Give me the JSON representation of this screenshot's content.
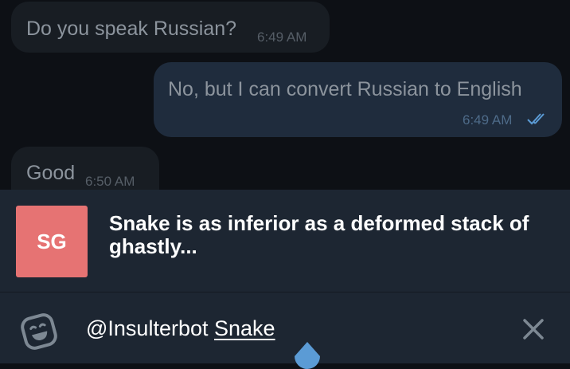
{
  "chat": {
    "messages": [
      {
        "direction": "incoming",
        "text": "Do you speak Russian?",
        "time": "6:49 AM"
      },
      {
        "direction": "outgoing",
        "text": "No, but I can convert Russian to English",
        "time": "6:49 AM",
        "status_icon": "double-check-icon"
      },
      {
        "direction": "incoming",
        "text": "Good",
        "time": "6:50 AM"
      }
    ]
  },
  "suggestion": {
    "avatar_initials": "SG",
    "avatar_color": "#e67373",
    "text": "Snake is as inferior as a deformed stack of ghastly..."
  },
  "input": {
    "mention": "@Insulterbot",
    "query": "Snake",
    "left_icon": "emoji-icon",
    "right_icon": "close-icon"
  },
  "colors": {
    "background": "#0d1015",
    "incoming_bubble": "#181d23",
    "outgoing_bubble": "#1f2c3d",
    "panel": "#1d2632",
    "accent": "#5b9bd5"
  }
}
